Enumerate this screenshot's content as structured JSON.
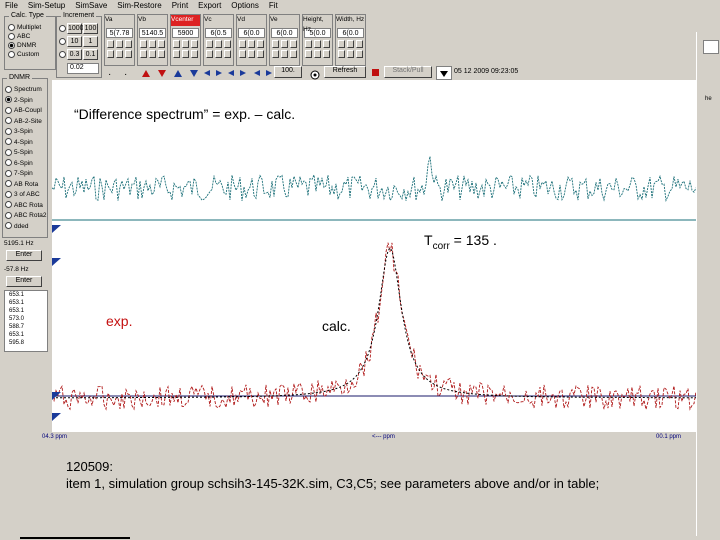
{
  "menu": [
    "File",
    "Sim-Setup",
    "SimSave",
    "Sim-Restore",
    "Print",
    "Export",
    "Options",
    "Fit"
  ],
  "calc_type": {
    "title": "Calc. Type",
    "options": [
      "Multiplet",
      "ABC",
      "DNMR",
      "Custom"
    ],
    "selected": 2
  },
  "increment": {
    "title": "Increment",
    "rows": [
      [
        "1000",
        "100"
      ],
      [
        "10",
        "1"
      ],
      [
        "0.3",
        "0.1"
      ]
    ],
    "field_value": "0.02"
  },
  "params": [
    {
      "head": "Va",
      "value": "5(7.78",
      "red": false
    },
    {
      "head": "Vb",
      "value": "5140.5",
      "red": false
    },
    {
      "head": "Vcenter",
      "value": "5900",
      "red": true
    },
    {
      "head": "Vc",
      "value": "6(0.5",
      "red": false
    },
    {
      "head": "Vd",
      "value": "6(0.0",
      "red": false
    },
    {
      "head": "Ve",
      "value": "6(0.0",
      "red": false
    },
    {
      "head": "Height, Hz",
      "value": "5(0.0",
      "red": false
    },
    {
      "head": "Width, Hz",
      "value": "6(0.0",
      "red": false
    }
  ],
  "toolbar": {
    "scale_value": "100.",
    "refresh_label": "Refresh",
    "stack_label": "Stack/Pull",
    "datetime": "05 12 2009   09:23:05"
  },
  "dnmr": {
    "title": "DNMR",
    "options": [
      "Spectrum",
      "2-Spin",
      "AB-Coupl",
      "AB-2-Site",
      "3-Spin",
      "4-Spin",
      "5-Spin",
      "6-Spin",
      "7-Spin",
      "AB Rota",
      "3 of ABC",
      "ABC Rota",
      "ABC Rota2",
      "dded"
    ],
    "selected": 1,
    "freq_label": "5195.1 Hz",
    "enter_label": "Enter",
    "offset_label": "-57.8 Hz",
    "enter2_label": "Enter",
    "list": [
      "653.1",
      "653.1",
      "653.1",
      "573.0",
      "588.7",
      "653.1",
      "595.8"
    ]
  },
  "axis": {
    "left_label": "04.3 ppm",
    "center_label": "<--- ppm",
    "right_label": "00.1 ppm"
  },
  "annotations": {
    "difference_title": "“Difference spectrum” = exp. – calc.",
    "tcorr_main": "T",
    "tcorr_sub": "corr",
    "tcorr_rest": " = 135 .",
    "exp_label": "exp.",
    "calc_label": "calc."
  },
  "caption": {
    "line1": "120509:",
    "line2": "item 1, simulation group schsih3-145-32K.sim,  C3,C5; see parameters above and/or in table;"
  },
  "right_strip_text": "he",
  "colors": {
    "difference_trace": "#1a6f78",
    "experimental_trace": "#b01818",
    "calculated_trace": "#000000",
    "axis_marker": "#1a3a9a"
  }
}
